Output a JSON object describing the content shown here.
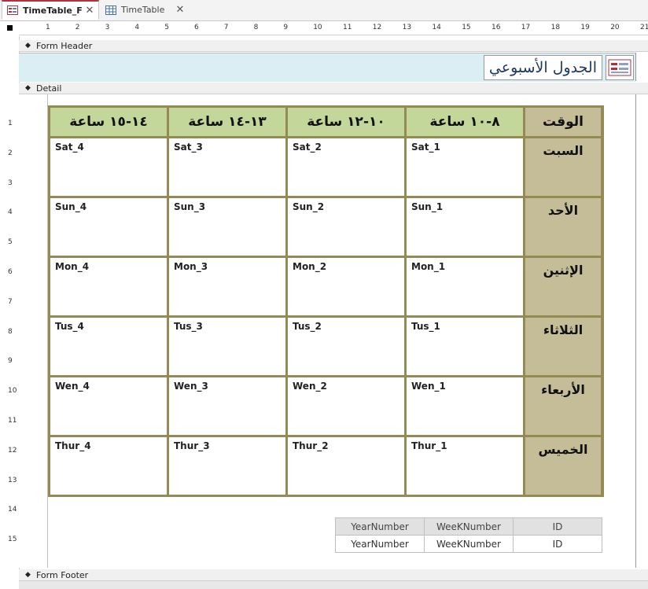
{
  "tabs": [
    {
      "label": "TimeTable_F",
      "active": true,
      "icon": "form-icon"
    },
    {
      "label": "TimeTable",
      "active": false,
      "icon": "table-icon"
    }
  ],
  "ruler": {
    "h_numbers": [
      "1",
      "2",
      "3",
      "4",
      "5",
      "6",
      "7",
      "8",
      "9",
      "10",
      "11",
      "12",
      "13",
      "14",
      "15",
      "16",
      "17",
      "18",
      "19",
      "20",
      "21"
    ],
    "v_numbers": [
      "1",
      "2",
      "3",
      "4",
      "5",
      "6",
      "7",
      "8",
      "9",
      "10",
      "11",
      "12",
      "13",
      "14",
      "15"
    ]
  },
  "sections": {
    "form_header": "Form Header",
    "detail": "Detail",
    "form_footer": "Form Footer"
  },
  "header": {
    "title": "الجدول الأسبوعي"
  },
  "timetable": {
    "corner": "الوقت",
    "slots": [
      "٨-١٠ ساعة",
      "١٠-١٢ ساعة",
      "١٣-١٤ ساعة",
      "١٤-١٥ ساعة"
    ],
    "days": [
      {
        "name": "السبت",
        "cells": [
          "Sat_1",
          "Sat_2",
          "Sat_3",
          "Sat_4"
        ]
      },
      {
        "name": "الأحد",
        "cells": [
          "Sun_1",
          "Sun_2",
          "Sun_3",
          "Sun_4"
        ]
      },
      {
        "name": "الإثنين",
        "cells": [
          "Mon_1",
          "Mon_2",
          "Mon_3",
          "Mon_4"
        ]
      },
      {
        "name": "الثلاثاء",
        "cells": [
          "Tus_1",
          "Tus_2",
          "Tus_3",
          "Tus_4"
        ]
      },
      {
        "name": "الأربعاء",
        "cells": [
          "Wen_1",
          "Wen_2",
          "Wen_3",
          "Wen_4"
        ]
      },
      {
        "name": "الخميس",
        "cells": [
          "Thur_1",
          "Thur_2",
          "Thur_3",
          "Thur_4"
        ]
      }
    ]
  },
  "id_table": {
    "labels": [
      "YearNumber",
      "WeeKNumber",
      "ID"
    ],
    "fields": [
      "YearNumber",
      "WeeKNumber",
      "ID"
    ]
  },
  "colors": {
    "grid_border": "#948a54",
    "header_cells": "#c4d79b",
    "day_cells": "#c4bd97",
    "header_band": "#daeef3"
  }
}
